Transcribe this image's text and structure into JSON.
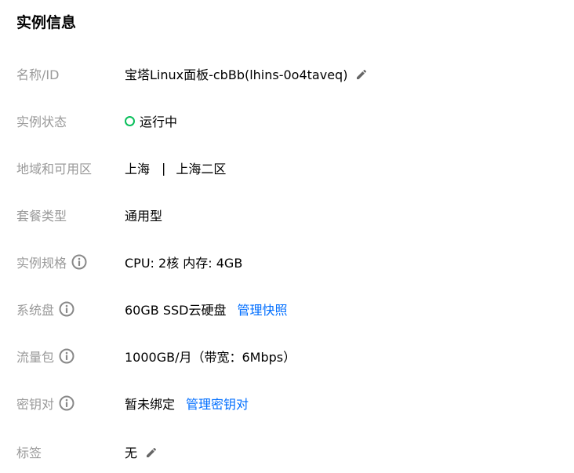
{
  "section_title": "实例信息",
  "rows": {
    "name": {
      "label": "名称/ID",
      "value": "宝塔Linux面板-cbBb(lhins-0o4taveq)"
    },
    "status": {
      "label": "实例状态",
      "value": "运行中",
      "status_color": "#0abf5b"
    },
    "region": {
      "label": "地域和可用区",
      "region": "上海",
      "separator": "|",
      "zone": "上海二区"
    },
    "package": {
      "label": "套餐类型",
      "value": "通用型"
    },
    "spec": {
      "label": "实例规格",
      "value": "CPU: 2核 内存: 4GB"
    },
    "disk": {
      "label": "系统盘",
      "value": "60GB SSD云硬盘",
      "link": "管理快照"
    },
    "traffic": {
      "label": "流量包",
      "value": "1000GB/月（带宽：6Mbps）"
    },
    "key": {
      "label": "密钥对",
      "value": "暂未绑定",
      "link": "管理密钥对"
    },
    "tags": {
      "label": "标签",
      "value": "无"
    }
  },
  "colors": {
    "label": "#999999",
    "value": "#000000",
    "link": "#006eff",
    "icon": "#888888"
  },
  "icons": {
    "info": "info-circle-icon",
    "edit": "pencil-edit-icon"
  }
}
